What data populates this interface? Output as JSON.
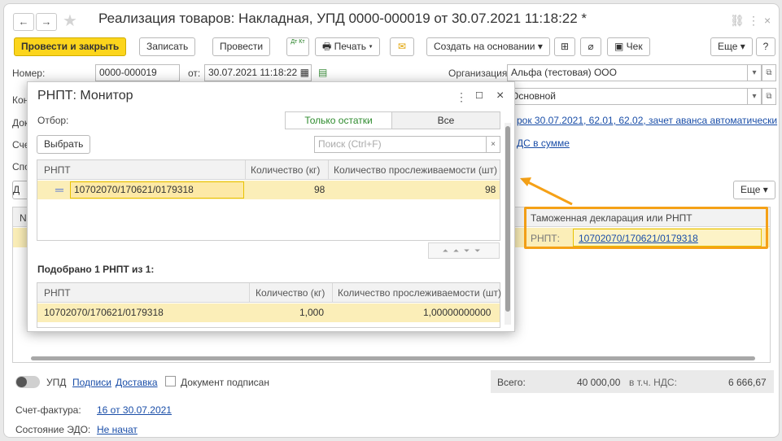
{
  "document": {
    "title": "Реализация товаров: Накладная, УПД 0000-000019 от 30.07.2021 11:18:22 *",
    "toolbar": {
      "post_close": "Провести и закрыть",
      "save": "Записать",
      "post": "Провести",
      "dtkt": "Дт Кт",
      "print": "Печать",
      "create_based": "Создать на основании",
      "receipt": "Чек",
      "more": "Еще",
      "help": "?"
    },
    "fields": {
      "number_label": "Номер:",
      "number_value": "0000-000019",
      "date_label": "от:",
      "date_value": "30.07.2021 11:18:22",
      "org_label": "Организация:",
      "org_value": "Альфа (тестовая) ООО",
      "contract_value": "Основной",
      "row_labels": [
        "Кон",
        "Док",
        "Сче",
        "Спо"
      ],
      "payment_link": "рок 30.07.2021, 62.01, 62.02, зачет аванса автоматически",
      "vat_link": "ДС в сумме"
    },
    "right_more": "Еще",
    "right_panel": {
      "col_header": "Таможенная декларация или РНПТ",
      "rnpt_label": "РНПТ:",
      "rnpt_value": "10702070/170621/0179318"
    },
    "left_partial": [
      "Д",
      "N"
    ],
    "footer": {
      "upd": "УПД",
      "signatures": "Подписи",
      "delivery": "Доставка",
      "signed": "Документ подписан",
      "total_label": "Всего:",
      "total_value": "40 000,00",
      "vat_label": "в т.ч. НДС:",
      "vat_value": "6 666,67",
      "invoice_label": "Счет-фактура:",
      "invoice_value": "16 от 30.07.2021",
      "edo_label": "Состояние ЭДО:",
      "edo_value": "Не начат"
    }
  },
  "modal": {
    "title": "РНПТ: Монитор",
    "filter_label": "Отбор:",
    "seg_only_balances": "Только остатки",
    "seg_all": "Все",
    "select_button": "Выбрать",
    "search_placeholder": "Поиск (Ctrl+F)",
    "top_table": {
      "headers": [
        "РНПТ",
        "Количество (кг)",
        "Количество прослеживаемости (шт)"
      ],
      "rows": [
        {
          "rnpt": "10702070/170621/0179318",
          "qty_kg": "98",
          "qty_trace": "98"
        }
      ]
    },
    "selected_caption": "Подобрано 1 РНПТ из 1:",
    "bottom_table": {
      "headers": [
        "РНПТ",
        "Количество (кг)",
        "Количество прослеживаемости (шт)"
      ],
      "rows": [
        {
          "rnpt": "10702070/170621/0179318",
          "qty_kg": "1,000",
          "qty_trace": "1,00000000000"
        }
      ]
    }
  },
  "colors": {
    "primary_button": "#fcd51c",
    "selection": "#fbeeb8",
    "accent_link": "#1a4ea8",
    "highlight": "#f5a117",
    "green_tab_text": "#2e8b2e"
  }
}
